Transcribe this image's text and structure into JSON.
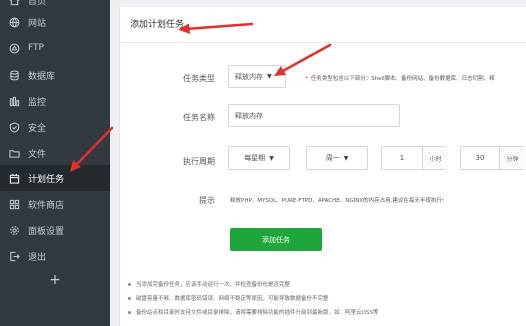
{
  "sidebar": {
    "items": [
      {
        "label": "首页",
        "icon": "home-icon"
      },
      {
        "label": "网站",
        "icon": "globe-icon"
      },
      {
        "label": "FTP",
        "icon": "ftp-icon"
      },
      {
        "label": "数据库",
        "icon": "database-icon"
      },
      {
        "label": "监控",
        "icon": "monitor-icon"
      },
      {
        "label": "安全",
        "icon": "shield-icon"
      },
      {
        "label": "文件",
        "icon": "folder-icon"
      },
      {
        "label": "计划任务",
        "icon": "calendar-icon",
        "active": true
      },
      {
        "label": "软件商店",
        "icon": "grid-icon"
      },
      {
        "label": "面板设置",
        "icon": "gear-icon"
      },
      {
        "label": "退出",
        "icon": "logout-icon"
      }
    ],
    "add_label": "+"
  },
  "panel": {
    "title": "添加计划任务",
    "task_type": {
      "label": "任务类型",
      "value": "释放内存",
      "hint": "任务类型包含以下部分：Shell脚本、备份网站、备份数据库、日志切割、释"
    },
    "task_name": {
      "label": "任务名称",
      "value": "释放内存"
    },
    "cycle": {
      "label": "执行周期",
      "period": "每星期",
      "weekday": "周一",
      "hour_value": "1",
      "hour_unit": "小时",
      "minute_value": "30",
      "minute_unit": "分钟"
    },
    "tip": {
      "label": "提示",
      "text": "释放PHP、MYSQL、PURE-FTPD、APACHE、NGINX的内存占用,建议在每天半夜执行!"
    },
    "submit_label": "添加任务",
    "notes": [
      "当添加完备份任务，应该手动运行一次，并检查备份包是否完整",
      "磁盘容量不够、数据库密码错误、网络不稳定等原因，可能导致数据备份不完整",
      "备份站点和目录时支持文件或目录排除，请将需要排除功能的插件升级到最新版，如：阿里云OSS等"
    ]
  },
  "colors": {
    "sidebar_bg": "#32393f",
    "accent_green": "#20a53a",
    "annotation_red": "#e0322c"
  }
}
